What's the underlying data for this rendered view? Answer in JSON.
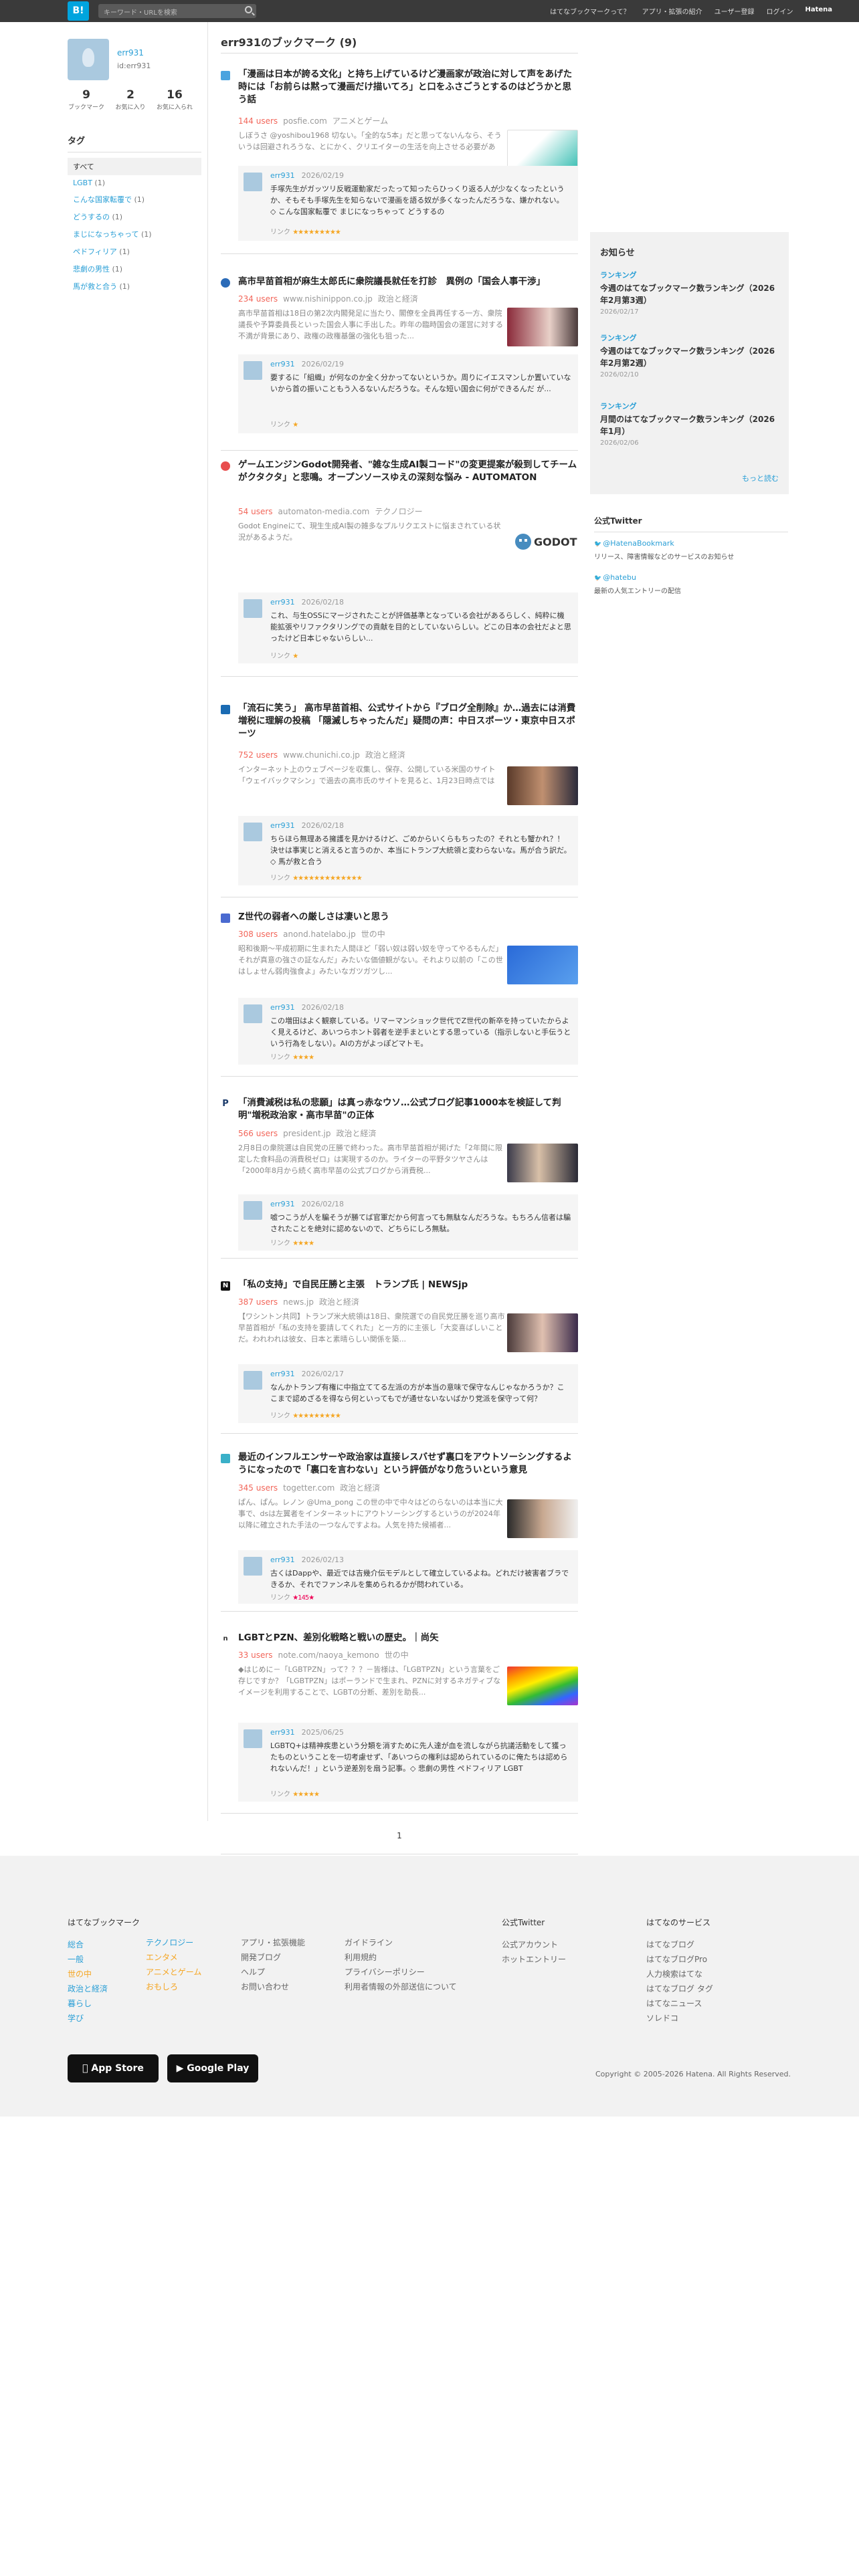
{
  "header": {
    "logo": "B!",
    "search_placeholder": "キーワード・URLを検索",
    "nav": [
      "はてなブックマークって？",
      "アプリ・拡張の紹介",
      "ユーザー登録",
      "ログイン",
      "Hatena"
    ]
  },
  "profile": {
    "name": "err931",
    "id": "id:err931",
    "stats": [
      {
        "value": "9",
        "label": "ブックマーク"
      },
      {
        "value": "2",
        "label": "お気に入り"
      },
      {
        "value": "16",
        "label": "お気に入られ"
      }
    ]
  },
  "tags": {
    "heading": "タグ",
    "all": "すべて",
    "items": [
      {
        "name": "LGBT",
        "count": "(1)"
      },
      {
        "name": "こんな国家転覆で",
        "count": "(1)"
      },
      {
        "name": "どうするの",
        "count": "(1)"
      },
      {
        "name": "まじになっちゃって",
        "count": "(1)"
      },
      {
        "name": "ペドフィリア",
        "count": "(1)"
      },
      {
        "name": "悲劇の男性",
        "count": "(1)"
      },
      {
        "name": "馬が救と合う",
        "count": "(1)"
      }
    ]
  },
  "main": {
    "title": "err931のブックマーク (9)",
    "entries": [
      {
        "title": "「漫画は日本が誇る文化」と持ち上げているけど漫画家が政治に対して声をあげた時には「お前らは黙って漫画だけ描いてろ」と口をふさごうとするのはどうかと思う話",
        "users": "144 users",
        "domain": "posfie.com",
        "category": "アニメとゲーム",
        "summary": "しぼうさ @yoshibou1968 切ない。「全的な5本」だと思ってないんなら、そういうは回避されろうな、とにかく、クリエイターの生活を向上させる必要がある。まずは、インボイス制度の廃止、次は、そもそも...",
        "comment": {
          "user": "err931",
          "date": "2026/02/19",
          "text": "手塚先生がガッツリ反戦運動家だったって知ったらひっくり返る人が少なくなったというか、そもそも手塚先生を知らないで漫画を語る奴が多くなったんだろうな、嫌かれない。 ◇ こんな国家転覆で まじになっちゃって どうするの",
          "link": "リンク",
          "stars": "★★★★★★★★★"
        }
      },
      {
        "title": "高市早苗首相が麻生太郎氏に衆院議長就任を打診　異例の「国会人事干渉」",
        "users": "234 users",
        "domain": "www.nishinippon.co.jp",
        "category": "政治と経済",
        "summary": "高市早苗首相は18日の第2次内閣発足に当たり、閣僚を全員再任する一方、衆院議長や予算委員長といった国会人事に手出した。昨年の臨時国会の運営に対する不満が背景にあり、政権の政権基盤の強化も狙った...",
        "comment": {
          "user": "err931",
          "date": "2026/02/19",
          "text": "要するに「組織」が何なのか全く分かってないというか。周りにイエスマンしか置いていないから首の振いこともう入るないんだろうな。そんな短い国会に何ができるんだ が...",
          "link": "リンク",
          "stars": "★"
        }
      },
      {
        "title": "ゲームエンジンGodot開発者、\"雑な生成AI製コード\"の変更提案が殺到してチームがクタクタ」と悲鳴。オープンソースゆえの深刻な悩み - AUTOMATON",
        "users": "54 users",
        "domain": "automaton-media.com",
        "category": "テクノロジー",
        "summary": "Godot Engineにて、現生生成AI製の雑多なプルリクエストに悩まされている状況があるようだ。",
        "comment": {
          "user": "err931",
          "date": "2026/02/18",
          "text": "これ、与生OSSにマージされたことが評価基準となっている会社があるらしく、純粋に機能拡張やリファクタリングでの貢献を目的としていないらしい。どこの日本の会社だよと思ったけど日本じゃないらしい...",
          "link": "リンク",
          "stars": "★"
        }
      },
      {
        "title": "「流石に笑う」 高市早苗首相、公式サイトから『ブログ全削除』か…過去には消費増税に理解の投稿 「隠滅しちゃったんだ」疑問の声：中日スポーツ・東京中日スポーツ",
        "users": "752 users",
        "domain": "www.chunichi.co.jp",
        "category": "政治と経済",
        "summary": "インターネット上のウェブページを収集し、保存、公開している米国のサイト「ウェイバックマシン」で過去の高市氏のサイトを見ると、1月23日時点では「コンテンツ」一覧内に「コラム」と称したブログの...",
        "comment": {
          "user": "err931",
          "date": "2026/02/18",
          "text": "ちらほら無理ある擁護を見かけるけど、ごめからいくらもちったの？それとも蟹かれ？！決せは事実じと消えると言うのか、本当にトランプ大統領と変わらないな。馬が合う訳だ。◇ 馬が救と合う",
          "link": "リンク",
          "stars": "★★★★★★★★★★★★★"
        }
      },
      {
        "title": "Z世代の弱者への厳しさは凄いと思う",
        "users": "308 users",
        "domain": "anond.hatelabo.jp",
        "category": "世の中",
        "summary": "昭和後期〜平成初期に生まれた人間ほど「弱い奴は弱い奴を守ってやるもんだ」それが真意の強さの証なんだ」みたいな価値観がない。それより以前の「この世はしょせん弱肉強食よ」みたいなガツガツし...",
        "comment": {
          "user": "err931",
          "date": "2026/02/18",
          "text": "この増田はよく観察している。リマーマンショック世代でZ世代の新卒を持っていたからよく見えるけど、あいつらホント弱者を逆手まといとする思っている（指示しないと手伝うという行為をしない）。AIの方がよっぽどマトモ。",
          "link": "リンク",
          "stars": "★★★★"
        }
      },
      {
        "title": "「消費減税は私の悲願」は真っ赤なウソ…公式ブログ記事1000本を検証して判明\"増税政治家・高市早苗\"の正体",
        "users": "566 users",
        "domain": "president.jp",
        "category": "政治と経済",
        "summary": "2月8日の衆院選は自民党の圧勝で終わった。高市早苗首相が掲げた「2年間に限定した食料品の消費税ゼロ」は実現するのか。ライターの平野タツヤさんは「2000年8月から続く高市早苗の公式ブログから消費税...",
        "comment": {
          "user": "err931",
          "date": "2026/02/18",
          "text": "嘘つこうが人を騙そうが勝てば官軍だから何言っても無駄なんだろうな。もちろん信者は騙されたことを絶対に認めないので、どちらにしろ無駄。",
          "link": "リンク",
          "stars": "★★★★"
        }
      },
      {
        "title": "「私の支持」で自民圧勝と主張　トランプ氏 | NEWSjp",
        "users": "387 users",
        "domain": "news.jp",
        "category": "政治と経済",
        "summary": "【ワシントン共同】トランプ米大統領は18日、衆院選での自民党圧勝を巡り高市早苗首相が「私の支持を要請してくれた」と一方的に主張し「大変喜ばしいことだ。われわれは彼女、日本と素晴らしい関係を築...",
        "comment": {
          "user": "err931",
          "date": "2026/02/17",
          "text": "なんかトランプ有権に中指立ててる左派の方が本当の意味で保守なんじゃなかろうか？ここまで認めざるを得なら何といってもでが通せないないばかり党派を保守って何？",
          "link": "リンク",
          "stars": "★★★★★★★★★"
        }
      },
      {
        "title": "最近のインフルエンサーや政治家は直接レスバせず裏口をアウトソーシングするようになったので「裏口を言わない」という評価がなり危ういという意見",
        "users": "345 users",
        "domain": "togetter.com",
        "category": "政治と経済",
        "summary": "ぱん、ぱん。レノン @Uma_pong この世の中で中々はどのらないのは本当に大事で、dsは左翼者をインターネットにアウトソーシングするというのが2024年以降に確立された手法の一つなんですよね。人気を持た候補者...",
        "comment": {
          "user": "err931",
          "date": "2026/02/13",
          "text": "古くはDappや、最近では吉幾介伝モデルとして確立しているよね。どれだけ被害者ブラできるか、それでファンネルを集められるかが問われている。",
          "link": "リンク",
          "stars": "★145★"
        }
      },
      {
        "title": "LGBTとPZN、差別化戦略と戦いの歴史。｜尚矢",
        "users": "33 users",
        "domain": "note.com/naoya_kemono",
        "category": "世の中",
        "summary": "◆はじめに－「LGBTPZN」って？？？－皆様は、「LGBTPZN」という言葉をご存じですか？「LGBTPZN」はポーランドで生まれ、PZNに対するネガティブなイメージを利用することで、LGBTの分断、差別を助長...",
        "comment": {
          "user": "err931",
          "date": "2025/06/25",
          "text": "LGBTQ+は精神疾患という分類を消すために先人達が血を流しながら抗議活動をして獲ったものということを一切考慮せず、「あいつらの権利は認められているのに俺たちは認められないんだ！」という逆差別を扇う記事。◇ 悲劇の男性 ペドフィリア LGBT",
          "link": "リンク",
          "stars": "★★★★★"
        }
      }
    ],
    "pager": "1"
  },
  "news": {
    "heading": "お知らせ",
    "items": [
      {
        "label": "ランキング",
        "title": "今週のはてなブックマーク数ランキング（2026年2月第3週）",
        "date": "2026/02/17"
      },
      {
        "label": "ランキング",
        "title": "今週のはてなブックマーク数ランキング（2026年2月第2週）",
        "date": "2026/02/10"
      },
      {
        "label": "ランキング",
        "title": "月間のはてなブックマーク数ランキング（2026年1月）",
        "date": "2026/02/06"
      }
    ],
    "more": "もっと読む"
  },
  "twitter": {
    "heading": "公式Twitter",
    "accounts": [
      {
        "handle": "@HatenaBookmark",
        "desc": "リリース、障害情報などのサービスのお知らせ"
      },
      {
        "handle": "@hatebu",
        "desc": "最新の人気エントリーの配信"
      }
    ]
  },
  "footer": {
    "col1_heading": "はてなブックマーク",
    "cats_a": [
      "総合",
      "一般",
      "世の中",
      "政治と経済",
      "暮らし",
      "学び"
    ],
    "cats_b": [
      "テクノロジー",
      "エンタメ",
      "アニメとゲーム",
      "おもしろ"
    ],
    "col3": [
      "アプリ・拡張機能",
      "開発ブログ",
      "ヘルプ",
      "お問い合わせ"
    ],
    "col4": [
      "ガイドライン",
      "利用規約",
      "プライバシーポリシー",
      "利用者情報の外部送信について"
    ],
    "twitter_heading": "公式Twitter",
    "twitter_links": [
      "公式アカウント",
      "ホットエントリー"
    ],
    "services_heading": "はてなのサービス",
    "services": [
      "はてなブログ",
      "はてなブログPro",
      "人力検索はてな",
      "はてなブログ タグ",
      "はてなニュース",
      "ソレドコ"
    ],
    "app_store": "App Store",
    "google_play": "Google Play",
    "copyright": "Copyright © 2005-2026 Hatena. All Rights Reserved."
  }
}
